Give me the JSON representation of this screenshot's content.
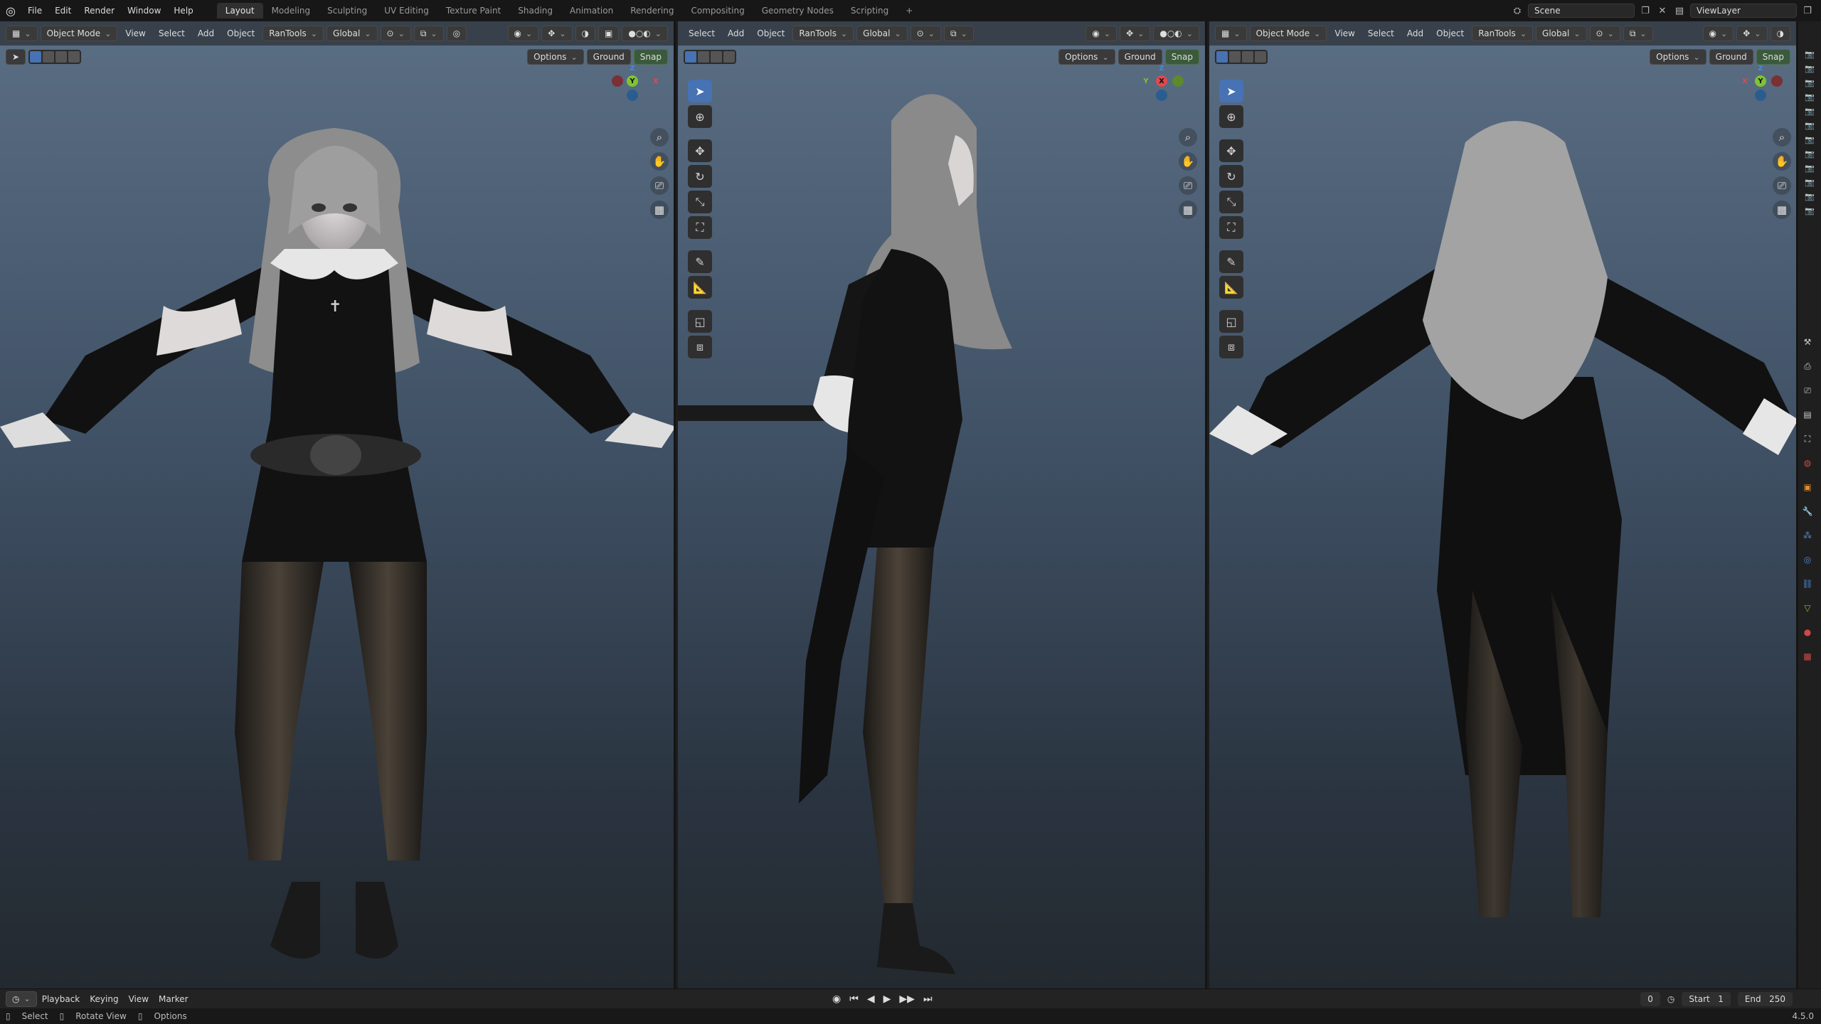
{
  "menu": {
    "logo_icon": "blender-logo-icon",
    "items": [
      "File",
      "Edit",
      "Render",
      "Window",
      "Help"
    ]
  },
  "tabs": [
    "Layout",
    "Modeling",
    "Sculpting",
    "UV Editing",
    "Texture Paint",
    "Shading",
    "Animation",
    "Rendering",
    "Compositing",
    "Geometry Nodes",
    "Scripting"
  ],
  "active_tab": "Layout",
  "scene": {
    "label": "Scene"
  },
  "view_layer": {
    "label": "ViewLayer"
  },
  "viewport_header": {
    "mode": "Object Mode",
    "view": "View",
    "select": "Select",
    "add": "Add",
    "object": "Object",
    "addon": "RanTools",
    "orientation": "Global"
  },
  "viewport_header_mid": {
    "select": "Select",
    "add": "Add",
    "object": "Object",
    "addon": "RanTools",
    "orientation": "Global"
  },
  "overlay_row": {
    "options": "Options",
    "ground": "Ground",
    "snap": "Snap"
  },
  "gizmo": {
    "z": "Z",
    "y": "Y",
    "x": "X"
  },
  "timeline": {
    "playback": "Playback",
    "keying": "Keying",
    "view": "View",
    "marker": "Marker",
    "current_frame": "0",
    "start_label": "Start",
    "start_value": "1",
    "end_label": "End",
    "end_value": "250"
  },
  "status": {
    "select": "Select",
    "rotate_view": "Rotate View",
    "options": "Options",
    "version": "4.5.0"
  },
  "colors": {
    "accent": "#4772b3",
    "x_axis": "#e0484d",
    "y_axis": "#7ec433",
    "z_axis": "#3f8ddb"
  }
}
